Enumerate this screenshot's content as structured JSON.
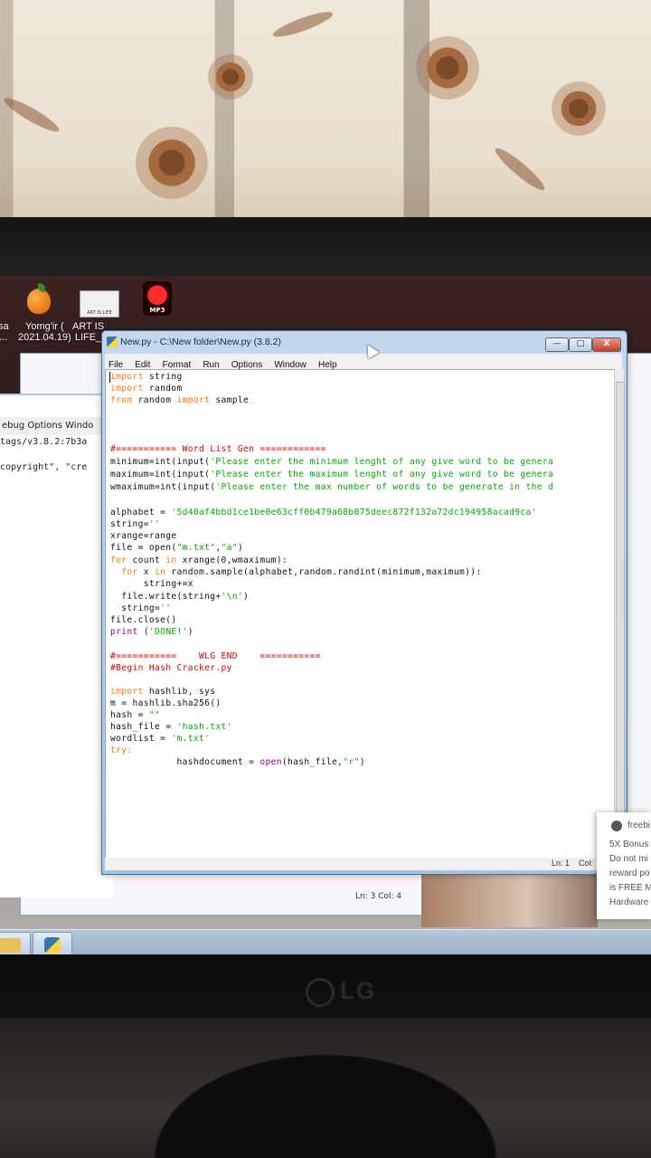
{
  "desktop": {
    "icons": [
      {
        "name": "Yomg'ir (",
        "sub": "2021.04.19)"
      },
      {
        "name": "ART IS",
        "sub": "LIFE_"
      },
      {
        "name": "Yomg'ir (",
        "sub": ""
      }
    ],
    "left_label_1": "sa",
    "left_label_2": "...",
    "art_icon_text": "ART IS LIFE",
    "mp3_icon_text": "MP3"
  },
  "shell": {
    "menu": "ebug  Options  Windo",
    "line1": "tags/v3.8.2:7b3a",
    "line2": "copyright\", \"cre"
  },
  "background_window": {
    "status": "Ln: 3   Col: 4"
  },
  "editor_window": {
    "title": "New.py - C:\\New folder\\New.py (3.8.2)",
    "menu": [
      "File",
      "Edit",
      "Format",
      "Run",
      "Options",
      "Window",
      "Help"
    ],
    "status": {
      "line": "Ln: 1",
      "col": "Col:"
    },
    "buttons": {
      "minimize": "—",
      "maximize": "□",
      "close": "X"
    }
  },
  "code": [
    {
      "t": "kw",
      "v": "import"
    },
    {
      "t": "",
      "v": " string"
    },
    {
      "t": "nl"
    },
    {
      "t": "kw",
      "v": "import"
    },
    {
      "t": "",
      "v": " random"
    },
    {
      "t": "nl"
    },
    {
      "t": "kw",
      "v": "from"
    },
    {
      "t": "",
      "v": " random "
    },
    {
      "t": "kw",
      "v": "import"
    },
    {
      "t": "",
      "v": " sample"
    }
  ],
  "lines": {
    "l1a": "import",
    "l1b": " string",
    "l2a": "import",
    "l2b": " random",
    "l3a": "from",
    "l3b": " random ",
    "l3c": "import",
    "l3d": " sample",
    "c1": "#=========== Word List Gen ============",
    "l5a": "minimum=int(input(",
    "l5b": "'Please enter the minimum lenght of any give word to be genera",
    "l6a": "maximum=int(input(",
    "l6b": "'Please enter the maximum lenght of any give word to be genera",
    "l7a": "wmaximum=int(input(",
    "l7b": "'Please enter the max number of words to be generate in the d",
    "l8a": "alphabet = ",
    "l8b": "'5d40af4bbd1ce1be0e63cff0b479a68b075deec872f132a72dc194958acad9ca'",
    "l9a": "string=",
    "l9b": "''",
    "l10": "xrange=range",
    "l11a": "file = open(",
    "l11b": "\"m.txt\"",
    "l11c": ",",
    "l11d": "\"a\"",
    "l11e": ")",
    "l12a": "for",
    "l12b": " count ",
    "l12c": "in",
    "l12d": " xrange(0,wmaximum):",
    "l13a": "  for",
    "l13b": " x ",
    "l13c": "in",
    "l13d": " random.sample(alphabet,random.randint(minimum,maximum)):",
    "l14": "      string+=x",
    "l15a": "  file.write(string+",
    "l15b": "'\\n'",
    "l15c": ")",
    "l16a": "  string=",
    "l16b": "''",
    "l17": "file.close()",
    "l18a": "print",
    "l18b": " (",
    "l18c": "'DONE!'",
    "l18d": ")",
    "c2": "#===========    WLG END    ===========",
    "c3": "#Begin Hash Cracker.py",
    "l21a": "import",
    "l21b": " hashlib, sys",
    "l22": "m = hashlib.sha256()",
    "l23a": "hash = ",
    "l23b": "\"\"",
    "l24a": "hash_file = ",
    "l24b": "'hash.txt'",
    "l25a": "wordlist = ",
    "l25b": "'m.txt'",
    "l26": "try:",
    "l27a": "            hashdocument = ",
    "l27b": "open",
    "l27c": "(hash_file,",
    "l27d": "\"r\"",
    "l27e": ")"
  },
  "notification": {
    "app": "freebi",
    "line1": "5X Bonus",
    "line2": "Do not mi",
    "line3": "reward po",
    "line4": "is FREE MO",
    "line5": "Hardware"
  },
  "monitor_brand": "LG",
  "colors": {
    "keyword": "#ff7700",
    "string": "#00aa00",
    "comment": "#dd0000",
    "builtin": "#900090"
  }
}
